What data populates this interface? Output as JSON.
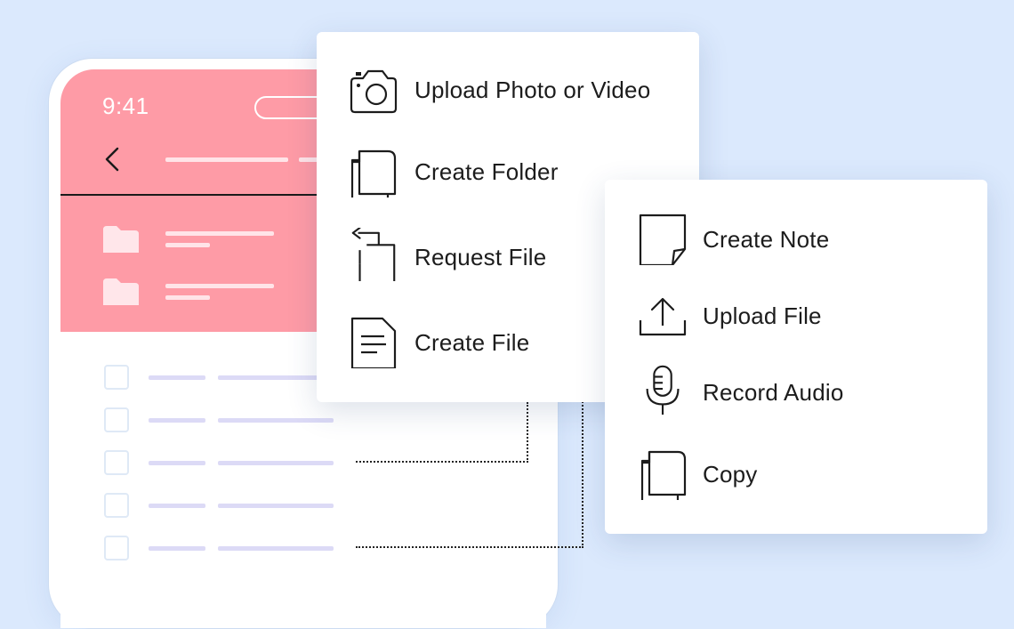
{
  "phone": {
    "status_time": "9:41"
  },
  "primary_menu": {
    "items": [
      {
        "label": "Upload Photo or Video",
        "icon": "camera-icon"
      },
      {
        "label": "Create Folder",
        "icon": "folder-stack-icon"
      },
      {
        "label": "Request File",
        "icon": "request-file-icon"
      },
      {
        "label": "Create File",
        "icon": "document-icon"
      }
    ]
  },
  "secondary_menu": {
    "items": [
      {
        "label": "Create Note",
        "icon": "note-icon"
      },
      {
        "label": "Upload File",
        "icon": "upload-icon"
      },
      {
        "label": "Record Audio",
        "icon": "microphone-icon"
      },
      {
        "label": "Copy",
        "icon": "copy-icon"
      }
    ]
  },
  "colors": {
    "background": "#dbe9fd",
    "header": "#fe9ba6",
    "accent_line": "#dcdaf6",
    "text": "#1c1c1c"
  }
}
